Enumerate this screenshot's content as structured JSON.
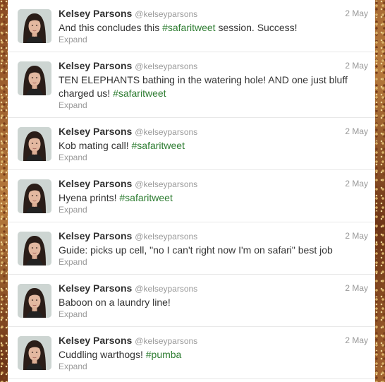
{
  "tweets": [
    {
      "name": "Kelsey Parsons",
      "handle": "@kelseyparsons",
      "time": "2 May",
      "text": "And this concludes this ",
      "hashtag": "#safaritweet",
      "text_after": " session. Success!",
      "expand": "Expand"
    },
    {
      "name": "Kelsey Parsons",
      "handle": "@kelseyparsons",
      "time": "2 May",
      "text": "TEN ELEPHANTS bathing in the watering hole! AND one just bluff charged us! ",
      "hashtag": "#safaritweet",
      "text_after": "",
      "expand": "Expand"
    },
    {
      "name": "Kelsey Parsons",
      "handle": "@kelseyparsons",
      "time": "2 May",
      "text": "Kob mating call! ",
      "hashtag": "#safaritweet",
      "text_after": "",
      "expand": "Expand"
    },
    {
      "name": "Kelsey Parsons",
      "handle": "@kelseyparsons",
      "time": "2 May",
      "text": "Hyena prints! ",
      "hashtag": "#safaritweet",
      "text_after": "",
      "expand": "Expand"
    },
    {
      "name": "Kelsey Parsons",
      "handle": "@kelseyparsons",
      "time": "2 May",
      "text": "Guide: picks up cell, \"no I can't right now I'm on safari\" best job",
      "hashtag": "",
      "text_after": "",
      "expand": "Expand"
    },
    {
      "name": "Kelsey Parsons",
      "handle": "@kelseyparsons",
      "time": "2 May",
      "text": "Baboon on a laundry line!",
      "hashtag": "",
      "text_after": "",
      "expand": "Expand"
    },
    {
      "name": "Kelsey Parsons",
      "handle": "@kelseyparsons",
      "time": "2 May",
      "text": "Cuddling warthogs! ",
      "hashtag": "#pumba",
      "text_after": "",
      "expand": "Expand"
    }
  ],
  "colors": {
    "hashtag": "#2e7d32",
    "name": "#333333",
    "meta": "#999999"
  }
}
